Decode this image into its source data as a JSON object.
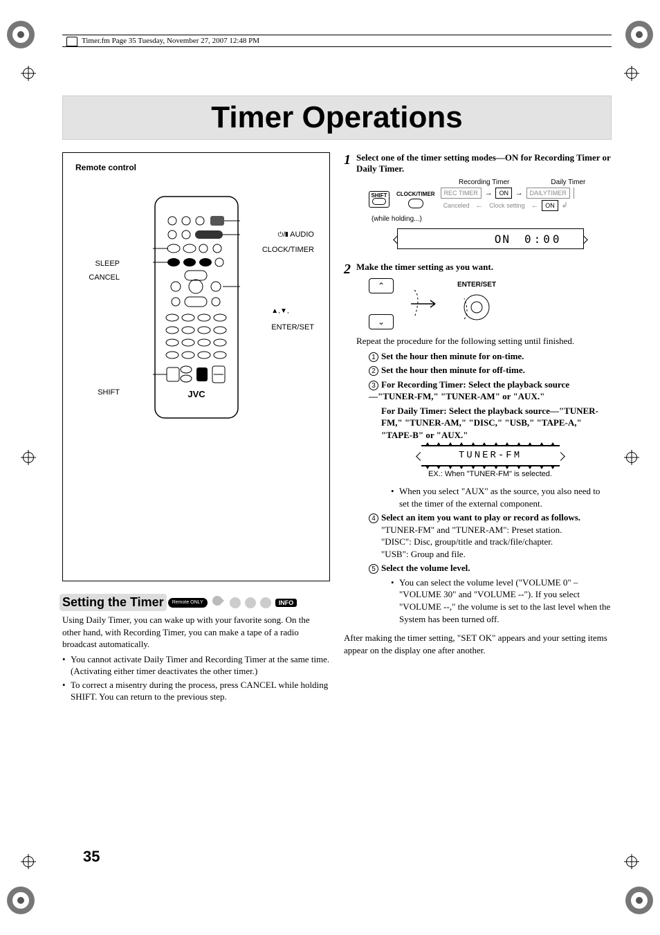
{
  "meta": {
    "headerLine": "Timer.fm  Page 35  Tuesday, November 27, 2007  12:48 PM",
    "pageNumber": "35"
  },
  "title": "Timer Operations",
  "remote": {
    "boxLabel": "Remote control",
    "brand": "JVC",
    "callouts": {
      "audio": "AUDIO",
      "clockTimer": "CLOCK/TIMER",
      "enterSet": "ENTER/SET",
      "upDownIcon": "▲,▼,",
      "sleep": "SLEEP",
      "cancel": "CANCEL",
      "shift": "SHIFT",
      "powerIcon": "⏻/❚"
    }
  },
  "section": {
    "heading": "Setting the Timer",
    "remoteOnlyBadge": "Remote ONLY",
    "infoBadge": "INFO",
    "intro": "Using Daily Timer, you can wake up with your favorite song. On the other hand, with Recording Timer, you can make a tape of a radio broadcast automatically.",
    "notes": [
      "You cannot activate Daily Timer and Recording Timer at the same time. (Activating either timer deactivates the other timer.)",
      "To correct a misentry during the process, press CANCEL while holding SHIFT. You can return to the previous step."
    ]
  },
  "steps": {
    "s1": {
      "num": "1",
      "lead": "Select one of the timer setting modes—ON for Recording Timer or Daily Timer.",
      "flow": {
        "recordingTimerLabel": "Recording Timer",
        "dailyTimerLabel": "Daily Timer",
        "shiftKey": "SHIFT",
        "clockTimerKey": "CLOCK/TIMER",
        "recTimer": "REC TIMER",
        "on1": "ON",
        "dailyTimer": "DAILYTIMER",
        "canceled": "Canceled",
        "clockSetting": "Clock setting",
        "on2": "ON",
        "whileHolding": "(while holding...)",
        "lcdOn": "ON",
        "lcdTime": "0:00"
      }
    },
    "s2": {
      "num": "2",
      "lead": "Make the timer setting as you want.",
      "enterSet": "ENTER/SET",
      "repeatText": "Repeat the procedure for the following setting until finished.",
      "items": {
        "i1": "Set the hour then minute for on-time.",
        "i2": "Set the hour then minute for off-time.",
        "i3a": "For Recording Timer: Select the playback source—\"TUNER-FM,\" \"TUNER-AM\" or \"AUX.\"",
        "i3b": "For Daily Timer: Select the playback source—\"TUNER-FM,\" \"TUNER-AM,\" \"DISC,\" \"USB,\" \"TAPE-A,\" \"TAPE-B\" or \"AUX.\"",
        "lcdSource": "TUNER-FM",
        "exampleCaption": "EX.: When \"TUNER-FM\" is selected.",
        "auxNote": "When you select \"AUX\" as the source, you also need to set the timer of the external component.",
        "i4lead": "Select an item you want to play or record as follows.",
        "i4a": "\"TUNER-FM\" and \"TUNER-AM\": Preset station.",
        "i4b": "\"DISC\": Disc, group/title and track/file/chapter.",
        "i4c": "\"USB\": Group and file.",
        "i5lead": "Select the volume level.",
        "i5note": "You can select the volume level (\"VOLUME 0\" – \"VOLUME 30\" and \"VOLUME --\"). If you select \"VOLUME --,\" the volume is set to the last level when the System has been turned off."
      },
      "closing": "After making the timer setting, \"SET OK\" appears and your setting items appear on the display one after another."
    }
  }
}
